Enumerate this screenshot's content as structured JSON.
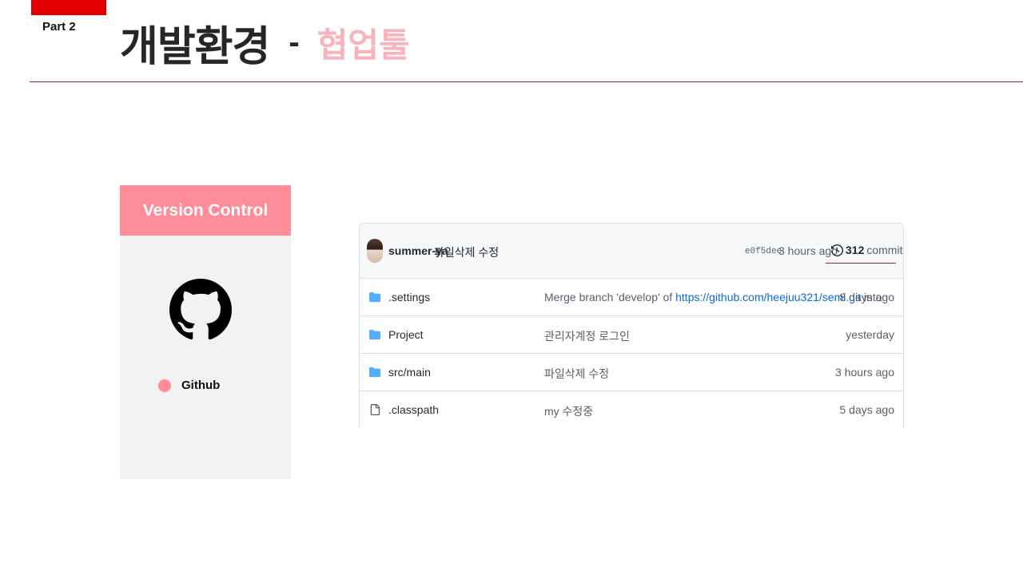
{
  "slide": {
    "part_label": "Part 2",
    "title": "개발환경",
    "title_separator": "-",
    "subtitle": "협업툴",
    "accent_color": "#e00000",
    "subtitle_color": "#f8b3bd"
  },
  "version_control": {
    "header": "Version Control",
    "logo_icon": "github-icon",
    "items": [
      {
        "label": "Github"
      }
    ],
    "header_color": "#ff8c99"
  },
  "repo": {
    "latest_commit": {
      "author": "summer-ya",
      "message": "파일삭제 수정",
      "hash": "e0f5dee",
      "time": "3 hours ago",
      "commits_count": "312",
      "commits_label": "commits",
      "history_icon": "history-icon"
    },
    "files": [
      {
        "type": "folder",
        "icon": "folder-icon",
        "name": ".settings",
        "message_prefix": "Merge branch 'develop' of ",
        "message_link": "https://github.com/heejuu321/semi.git",
        "message_suffix": " into",
        "time": "8 days ago"
      },
      {
        "type": "folder",
        "icon": "folder-icon",
        "name": "Project",
        "message_prefix": "관리자계정 로그인",
        "message_link": "",
        "message_suffix": "",
        "time": "yesterday"
      },
      {
        "type": "folder",
        "icon": "folder-icon",
        "name": "src/main",
        "message_prefix": "파일삭제 수정",
        "message_link": "",
        "message_suffix": "",
        "time": "3 hours ago"
      },
      {
        "type": "file",
        "icon": "file-icon",
        "name": ".classpath",
        "message_prefix": "my 수정중",
        "message_link": "",
        "message_suffix": "",
        "time": "5 days ago"
      }
    ]
  }
}
